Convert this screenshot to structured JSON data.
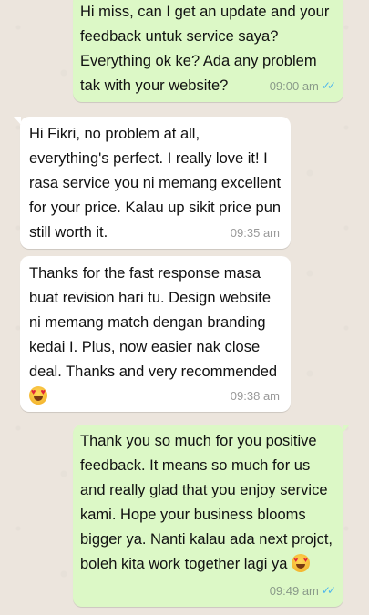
{
  "colors": {
    "outgoing_bubble": "#dcf8c6",
    "incoming_bubble": "#ffffff",
    "chat_background": "#ece5dd",
    "read_ticks": "#4fb6ec"
  },
  "messages": [
    {
      "direction": "outgoing",
      "text": "Hi miss, can I get an update and your feedback untuk service saya? Everything ok ke? Ada any problem tak with your website?",
      "time": "09:00 am",
      "status_icon": "double-check-read"
    },
    {
      "direction": "incoming",
      "text": "Hi Fikri, no problem at all, everything's perfect. I really love it! I rasa service you ni memang excellent for your price. Kalau up sikit price pun still worth it.",
      "time": "09:35 am"
    },
    {
      "direction": "incoming",
      "text": "Thanks for the fast response masa buat revision hari tu. Design website ni memang match dengan branding kedai I. Plus, now easier nak close deal. Thanks and very recommended",
      "emoji": "heart-eyes-emoji",
      "time": "09:38 am"
    },
    {
      "direction": "outgoing",
      "text": "Thank you so much for you positive feedback. It means so much for us and really glad that you enjoy service kami. Hope your business blooms bigger ya. Nanti kalau ada next projct, boleh kita work together lagi ya",
      "emoji": "heart-eyes-emoji",
      "time": "09:49 am",
      "status_icon": "double-check-read"
    }
  ]
}
